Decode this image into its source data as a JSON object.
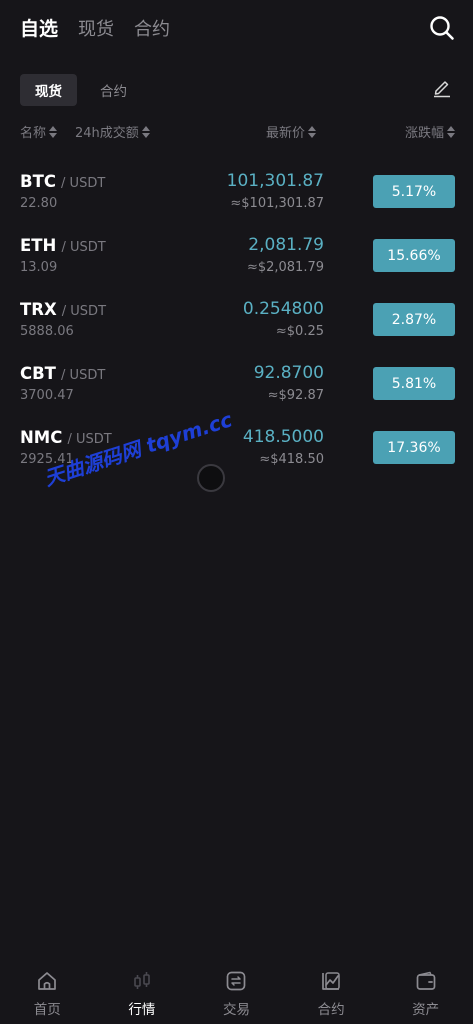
{
  "header": {
    "tabs": [
      "自选",
      "现货",
      "合约"
    ],
    "active_tab": "自选"
  },
  "sub_tabs": {
    "items": [
      "现货",
      "合约"
    ],
    "active": "现货"
  },
  "columns": {
    "name": "名称",
    "volume": "24h成交额",
    "price": "最新价",
    "change": "涨跌幅"
  },
  "rows": [
    {
      "base": "BTC",
      "quote": "/ USDT",
      "volume": "22.80",
      "price": "101,301.87",
      "fiat": "≈$101,301.87",
      "change": "5.17%"
    },
    {
      "base": "ETH",
      "quote": "/ USDT",
      "volume": "13.09",
      "price": "2,081.79",
      "fiat": "≈$2,081.79",
      "change": "15.66%"
    },
    {
      "base": "TRX",
      "quote": "/ USDT",
      "volume": "5888.06",
      "price": "0.254800",
      "fiat": "≈$0.25",
      "change": "2.87%"
    },
    {
      "base": "CBT",
      "quote": "/ USDT",
      "volume": "3700.47",
      "price": "92.8700",
      "fiat": "≈$92.87",
      "change": "5.81%"
    },
    {
      "base": "NMC",
      "quote": "/ USDT",
      "volume": "2925.41",
      "price": "418.5000",
      "fiat": "≈$418.50",
      "change": "17.36%"
    }
  ],
  "watermark": "天曲源码网 tqym.cc",
  "bottom_nav": {
    "items": [
      {
        "label": "首页",
        "icon": "home-icon"
      },
      {
        "label": "行情",
        "icon": "candlestick-icon"
      },
      {
        "label": "交易",
        "icon": "exchange-icon"
      },
      {
        "label": "合约",
        "icon": "contract-chart-icon"
      },
      {
        "label": "资产",
        "icon": "wallet-icon"
      }
    ],
    "active": "行情"
  },
  "colors": {
    "background": "#161519",
    "accent_price": "#5ab0c3",
    "change_badge": "#4ba1b4"
  }
}
